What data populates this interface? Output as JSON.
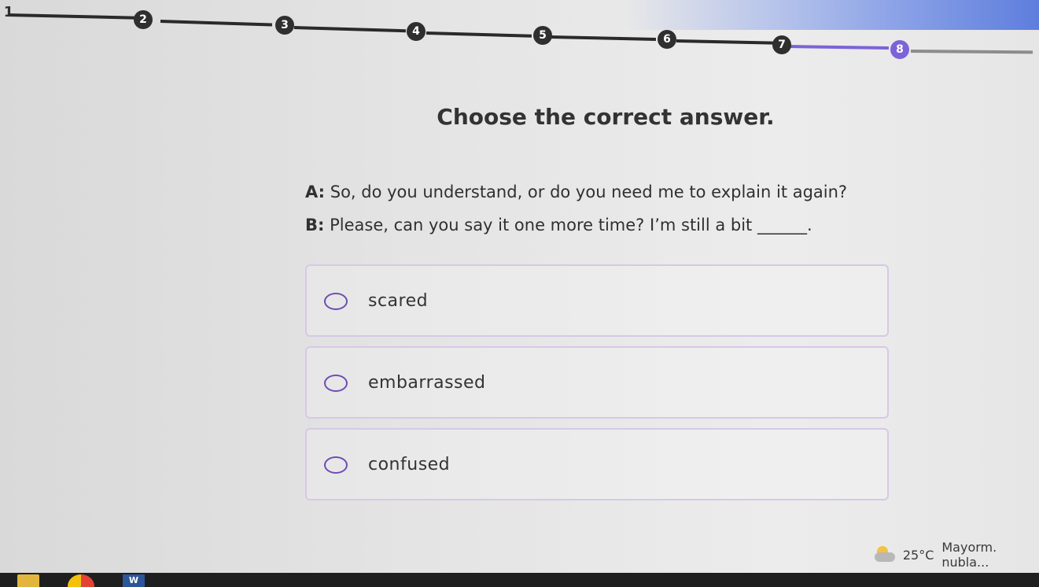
{
  "progress": {
    "steps": [
      "1",
      "2",
      "3",
      "4",
      "5",
      "6",
      "7",
      "8"
    ],
    "current_step": 8
  },
  "question": {
    "title": "Choose the correct answer.",
    "lines": [
      {
        "speaker": "A:",
        "text": "So, do you understand, or do you need me to explain it again?"
      },
      {
        "speaker": "B:",
        "text": "Please, can you say it one more time? I’m still a bit ______."
      }
    ]
  },
  "options": [
    {
      "label": "scared"
    },
    {
      "label": "embarrassed"
    },
    {
      "label": "confused"
    }
  ],
  "taskbar": {
    "weather_temp": "25°C",
    "weather_desc": "Mayorm. nubla...",
    "word_letter": "W"
  },
  "colors": {
    "accent": "#7c63d7",
    "radio_border": "#6f4bb3",
    "option_border": "#d7c8e7"
  },
  "icons": {
    "weather": "partly-cloudy-icon",
    "folder": "folder-icon",
    "browser": "chrome-icon",
    "word": "word-icon"
  }
}
